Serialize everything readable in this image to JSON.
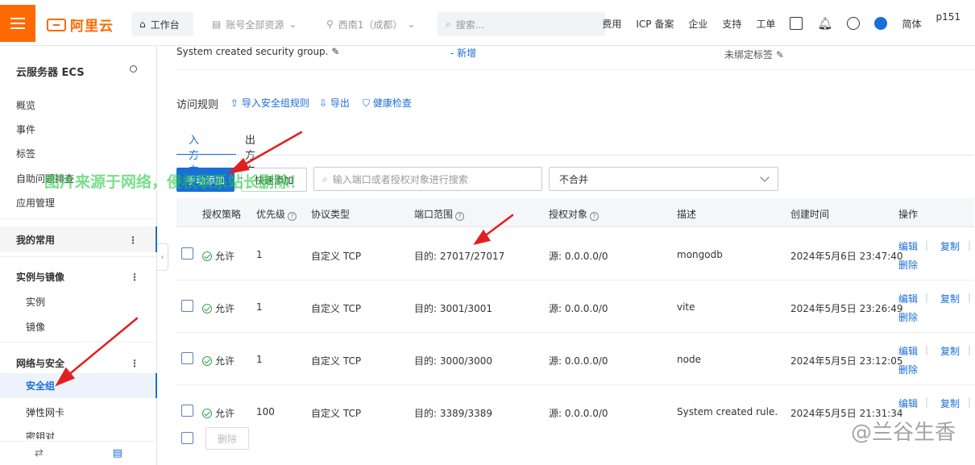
{
  "topbar": {
    "logo_text": "阿里云",
    "workbench": "工作台",
    "account": "账号全部资源",
    "region": "西南1（成都）",
    "search_placeholder": "搜索...",
    "links": [
      "费用",
      "ICP 备案",
      "企业",
      "支持",
      "工单"
    ],
    "lang": "简体",
    "user": "p151"
  },
  "sidebar": {
    "title": "云服务器 ECS",
    "items": [
      "概览",
      "事件",
      "标签",
      "自助问题排查",
      "应用管理"
    ],
    "groups": {
      "favorites": "我的常用",
      "instances": "实例与镜像",
      "network": "网络与安全"
    },
    "instance_sub": [
      "实例",
      "镜像"
    ],
    "network_sub": [
      "安全组",
      "弹性网卡",
      "密钥对"
    ]
  },
  "info": {
    "description": "System created security group.",
    "add": "新增",
    "tag": "未绑定标签"
  },
  "rules": {
    "title": "访问规则",
    "import": "导入安全组规则",
    "export": "导出",
    "health": "健康检查"
  },
  "tabs": [
    "入方向",
    "出方向"
  ],
  "actions": {
    "manual_add": "手动添加",
    "quick_add": "快速添加",
    "filter_placeholder": "输入端口或者授权对象进行搜索",
    "merge_select": "不合并"
  },
  "table": {
    "headers": [
      "授权策略",
      "优先级",
      "协议类型",
      "端口范围",
      "授权对象",
      "描述",
      "创建时间",
      "操作"
    ],
    "rows": [
      {
        "policy": "允许",
        "priority": "1",
        "protocol": "自定义 TCP",
        "port": "目的: 27017/27017",
        "source": "源: 0.0.0.0/0",
        "desc": "mongodb",
        "created": "2024年5月6日 23:47:40"
      },
      {
        "policy": "允许",
        "priority": "1",
        "protocol": "自定义 TCP",
        "port": "目的: 3001/3001",
        "source": "源: 0.0.0.0/0",
        "desc": "vite",
        "created": "2024年5月5日 23:26:49"
      },
      {
        "policy": "允许",
        "priority": "1",
        "protocol": "自定义 TCP",
        "port": "目的: 3000/3000",
        "source": "源: 0.0.0.0/0",
        "desc": "node",
        "created": "2024年5月5日 23:12:05"
      },
      {
        "policy": "允许",
        "priority": "100",
        "protocol": "自定义 TCP",
        "port": "目的: 3389/3389",
        "source": "源: 0.0.0.0/0",
        "desc": "System created rule.",
        "created": "2024年5月5日 21:31:34"
      }
    ],
    "op_edit": "编辑",
    "op_copy": "复制",
    "op_delete": "删除",
    "bulk_delete": "删除"
  },
  "overlays": {
    "green_watermark": "图片来源于网络，侵权联系站长删除！",
    "brand_watermark": "@兰谷生香"
  },
  "colors": {
    "brand_orange": "#ff6a00",
    "primary_blue": "#1a6ed8",
    "arrow_red": "#e02020"
  }
}
